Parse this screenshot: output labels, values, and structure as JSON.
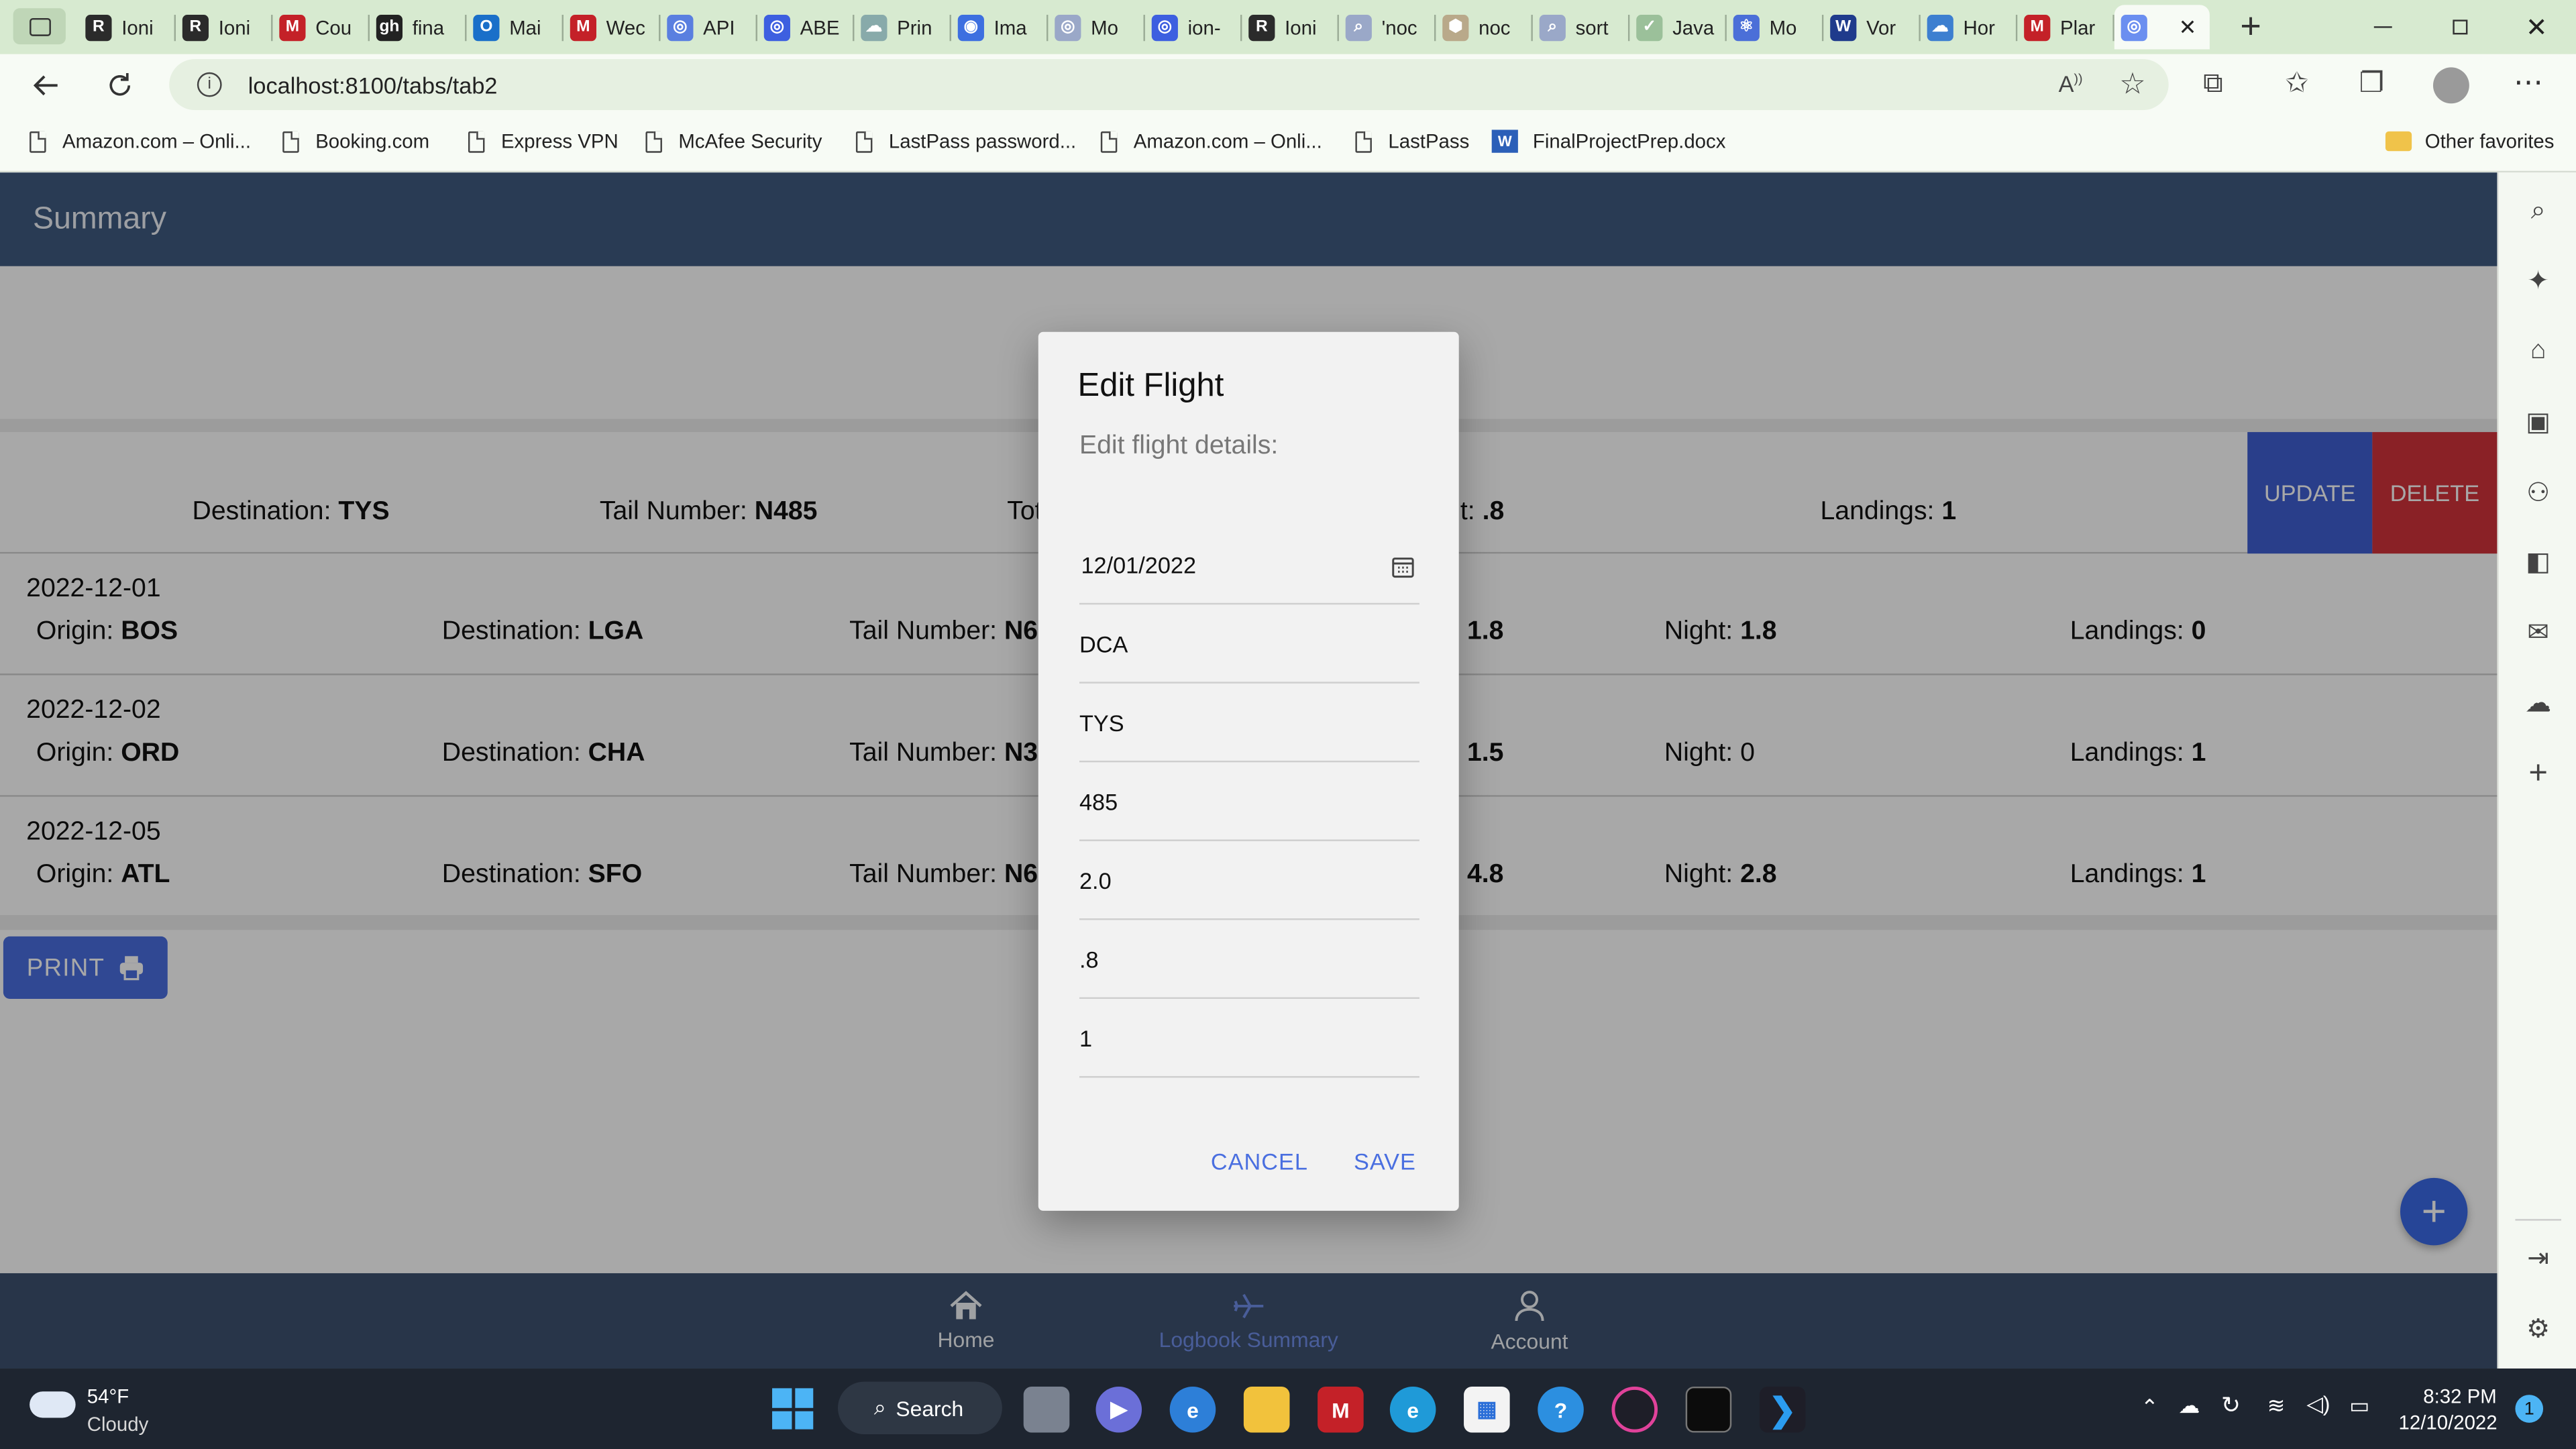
{
  "browser": {
    "tabs": [
      {
        "label": "Ioni",
        "favicon": "R",
        "color": "#2b2b2b"
      },
      {
        "label": "Ioni",
        "favicon": "R",
        "color": "#2b2b2b"
      },
      {
        "label": "Cou",
        "favicon": "M",
        "color": "#c42128"
      },
      {
        "label": "fina",
        "favicon": "gh",
        "color": "#222222"
      },
      {
        "label": "Mai",
        "favicon": "O",
        "color": "#1a6fc9"
      },
      {
        "label": "Wec",
        "favicon": "M",
        "color": "#c42128"
      },
      {
        "label": "API",
        "favicon": "◎",
        "color": "#5a7fe0"
      },
      {
        "label": "ABE",
        "favicon": "◎",
        "color": "#3d5fe0"
      },
      {
        "label": "Prin",
        "favicon": "☁",
        "color": "#8aa"
      },
      {
        "label": "Ima",
        "favicon": "◉",
        "color": "#3d6fe0"
      },
      {
        "label": "Mo",
        "favicon": "◎",
        "color": "#9aa8c8"
      },
      {
        "label": "ion-",
        "favicon": "◎",
        "color": "#3d5fe0"
      },
      {
        "label": "Ioni",
        "favicon": "R",
        "color": "#2b2b2b"
      },
      {
        "label": "'noc",
        "favicon": "⌕",
        "color": "#9aa8c8"
      },
      {
        "label": "noc",
        "favicon": "⬢",
        "color": "#b9a98a"
      },
      {
        "label": "sort",
        "favicon": "⌕",
        "color": "#9aa8c8"
      },
      {
        "label": "Java",
        "favicon": "✓",
        "color": "#9bc09a"
      },
      {
        "label": "Mo",
        "favicon": "⚛",
        "color": "#4b6fd8"
      },
      {
        "label": "Vor",
        "favicon": "W",
        "color": "#1f3b8c"
      },
      {
        "label": "Hor",
        "favicon": "☁",
        "color": "#3d7fd0"
      },
      {
        "label": "Plar",
        "favicon": "M",
        "color": "#c42128"
      },
      {
        "label": "",
        "favicon": "◎",
        "color": "#6b8ff0"
      }
    ],
    "new_tab_icon": "plus-icon",
    "address": "localhost:8100/tabs/tab2",
    "favorites": [
      {
        "label": "Amazon.com – Onli..."
      },
      {
        "label": "Booking.com"
      },
      {
        "label": "Express VPN"
      },
      {
        "label": "McAfee Security"
      },
      {
        "label": "LastPass password..."
      },
      {
        "label": "Amazon.com – Onli..."
      },
      {
        "label": "LastPass"
      },
      {
        "label": "FinalProjectPrep.docx"
      }
    ],
    "other_favorites": "Other favorites"
  },
  "app": {
    "title": "Summary",
    "selected_row": {
      "destination_label": "Destination:",
      "destination": "TYS",
      "tail_label": "Tail Number:",
      "tail": "N485",
      "total_fragment": "Tot",
      "night_fragment": "ht:",
      "night_value": ".8",
      "landings_label": "Landings:",
      "landings": "1",
      "update_label": "UPDATE",
      "delete_label": "DELETE"
    },
    "flights": [
      {
        "date": "2022-12-01",
        "origin": "BOS",
        "destination": "LGA",
        "tail": "N6",
        "total": "1.8",
        "night": "1.8",
        "landings": "0",
        "night_bold": true
      },
      {
        "date": "2022-12-02",
        "origin": "ORD",
        "destination": "CHA",
        "tail": "N3",
        "total": "1.5",
        "night": "0",
        "landings": "1",
        "night_bold": false
      },
      {
        "date": "2022-12-05",
        "origin": "ATL",
        "destination": "SFO",
        "tail": "N6",
        "total": "4.8",
        "night": "2.8",
        "landings": "1",
        "night_bold": true
      }
    ],
    "labels": {
      "origin": "Origin:",
      "destination": "Destination:",
      "tail": "Tail Number:",
      "night": "Night:",
      "landings": "Landings:"
    },
    "print_label": "PRINT",
    "fab_icon": "plus-icon",
    "nav": [
      {
        "label": "Home",
        "icon": "home-icon"
      },
      {
        "label": "Logbook Summary",
        "icon": "airplane-icon"
      },
      {
        "label": "Account",
        "icon": "person-icon"
      }
    ]
  },
  "modal": {
    "title": "Edit Flight",
    "subtitle": "Edit flight details:",
    "fields": [
      "12/01/2022",
      "DCA",
      "TYS",
      "485",
      "2.0",
      ".8",
      "1"
    ],
    "cancel": "CANCEL",
    "save": "SAVE"
  },
  "taskbar": {
    "weather_temp": "54°F",
    "weather_desc": "Cloudy",
    "search_label": "Search",
    "time": "8:32 PM",
    "date": "12/10/2022",
    "notifications": "1"
  },
  "colors": {
    "header": "#3f5a80",
    "update": "#3f5fd2",
    "delete": "#d2333b",
    "accent": "#4a6fe0",
    "tabbar": "#d7ead0"
  }
}
